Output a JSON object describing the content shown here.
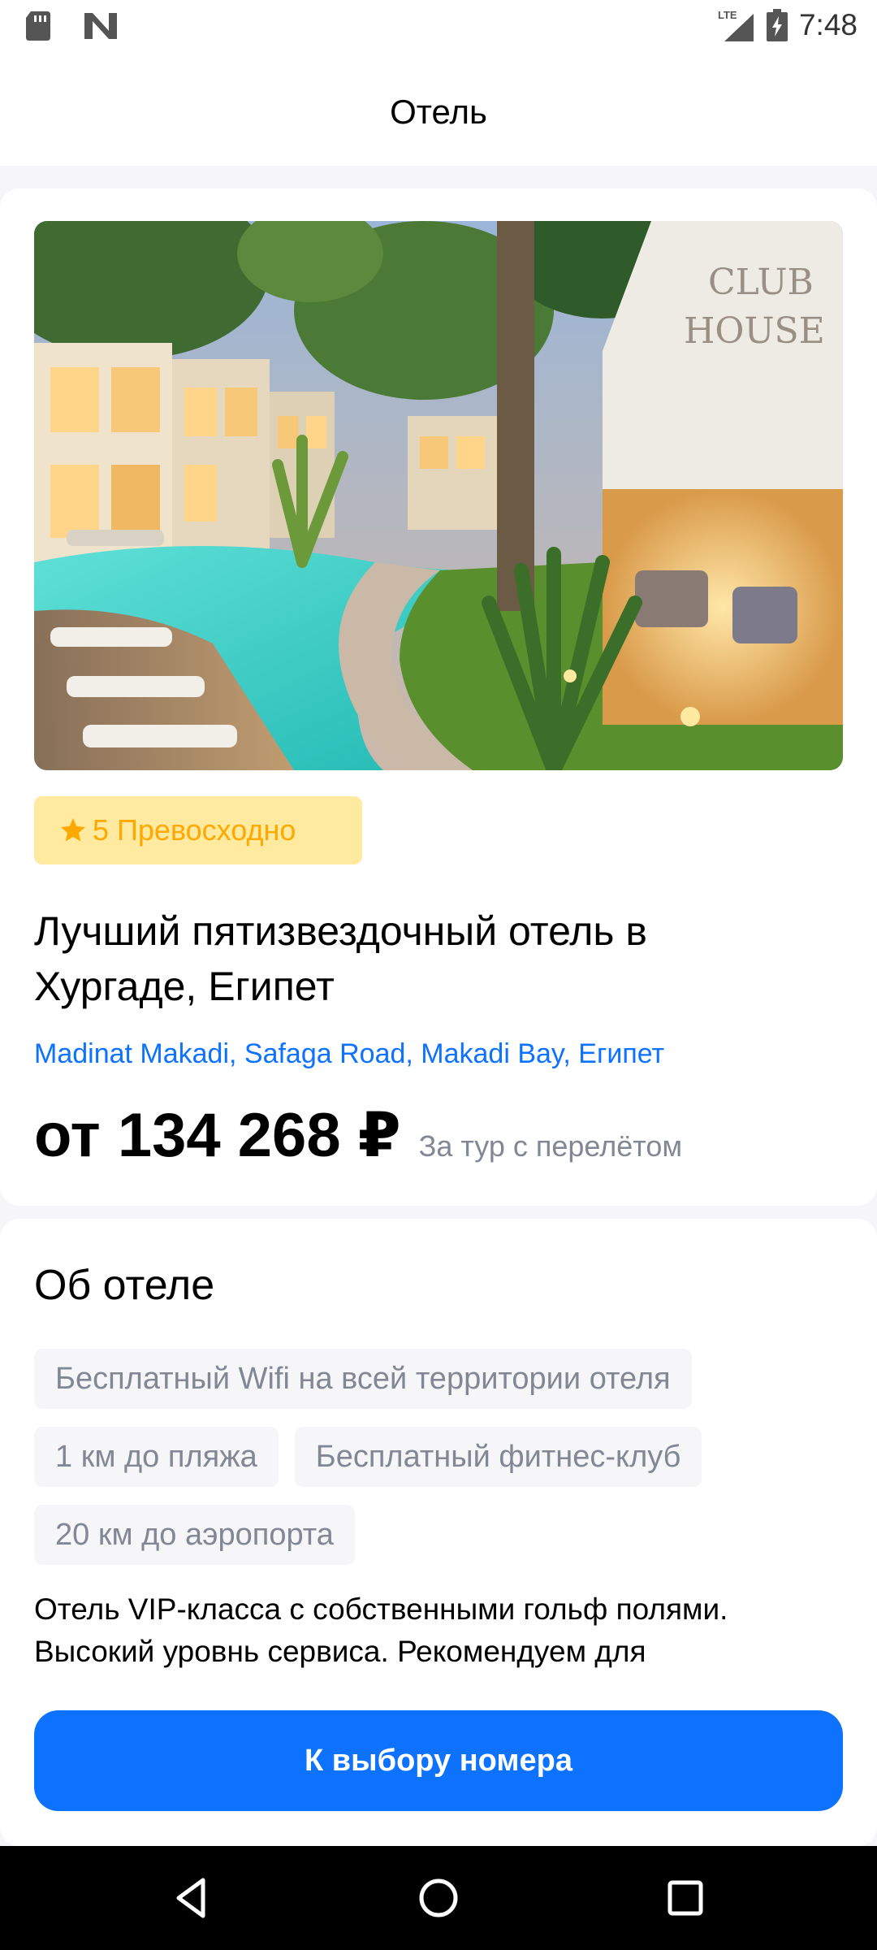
{
  "status_bar": {
    "time": "7:48",
    "network": "LTE",
    "icons": [
      "sd-card-icon",
      "notification-n-icon",
      "signal-icon",
      "battery-charging-icon"
    ]
  },
  "header": {
    "title": "Отель"
  },
  "hotel": {
    "image_alt": "Отель",
    "rating_value": "5",
    "rating_label": "5 Превосходно",
    "name": "Лучший пятизвездочный отель в Хургаде, Египет",
    "address": "Madinat Makadi, Safaga Road, Makadi Bay, Египет",
    "price": "от 134 268 ₽",
    "price_note": "За тур с перелётом"
  },
  "about": {
    "title": "Об отеле",
    "features": [
      "Бесплатный Wifi на всей территории отеля",
      "1 км до пляжа",
      "Бесплатный фитнес-клуб",
      "20 км до аэропорта"
    ],
    "description": "Отель VIP-класса с собственными гольф полями. Высокий уровнь сервиса. Рекомендуем для"
  },
  "actions": {
    "choose_room": "К выбору номера"
  },
  "colors": {
    "accent": "#0d72ff",
    "rating_bg": "#ffeaa0",
    "rating_text": "#ffa800",
    "muted_text": "#828796",
    "page_bg": "#f6f6f9"
  }
}
